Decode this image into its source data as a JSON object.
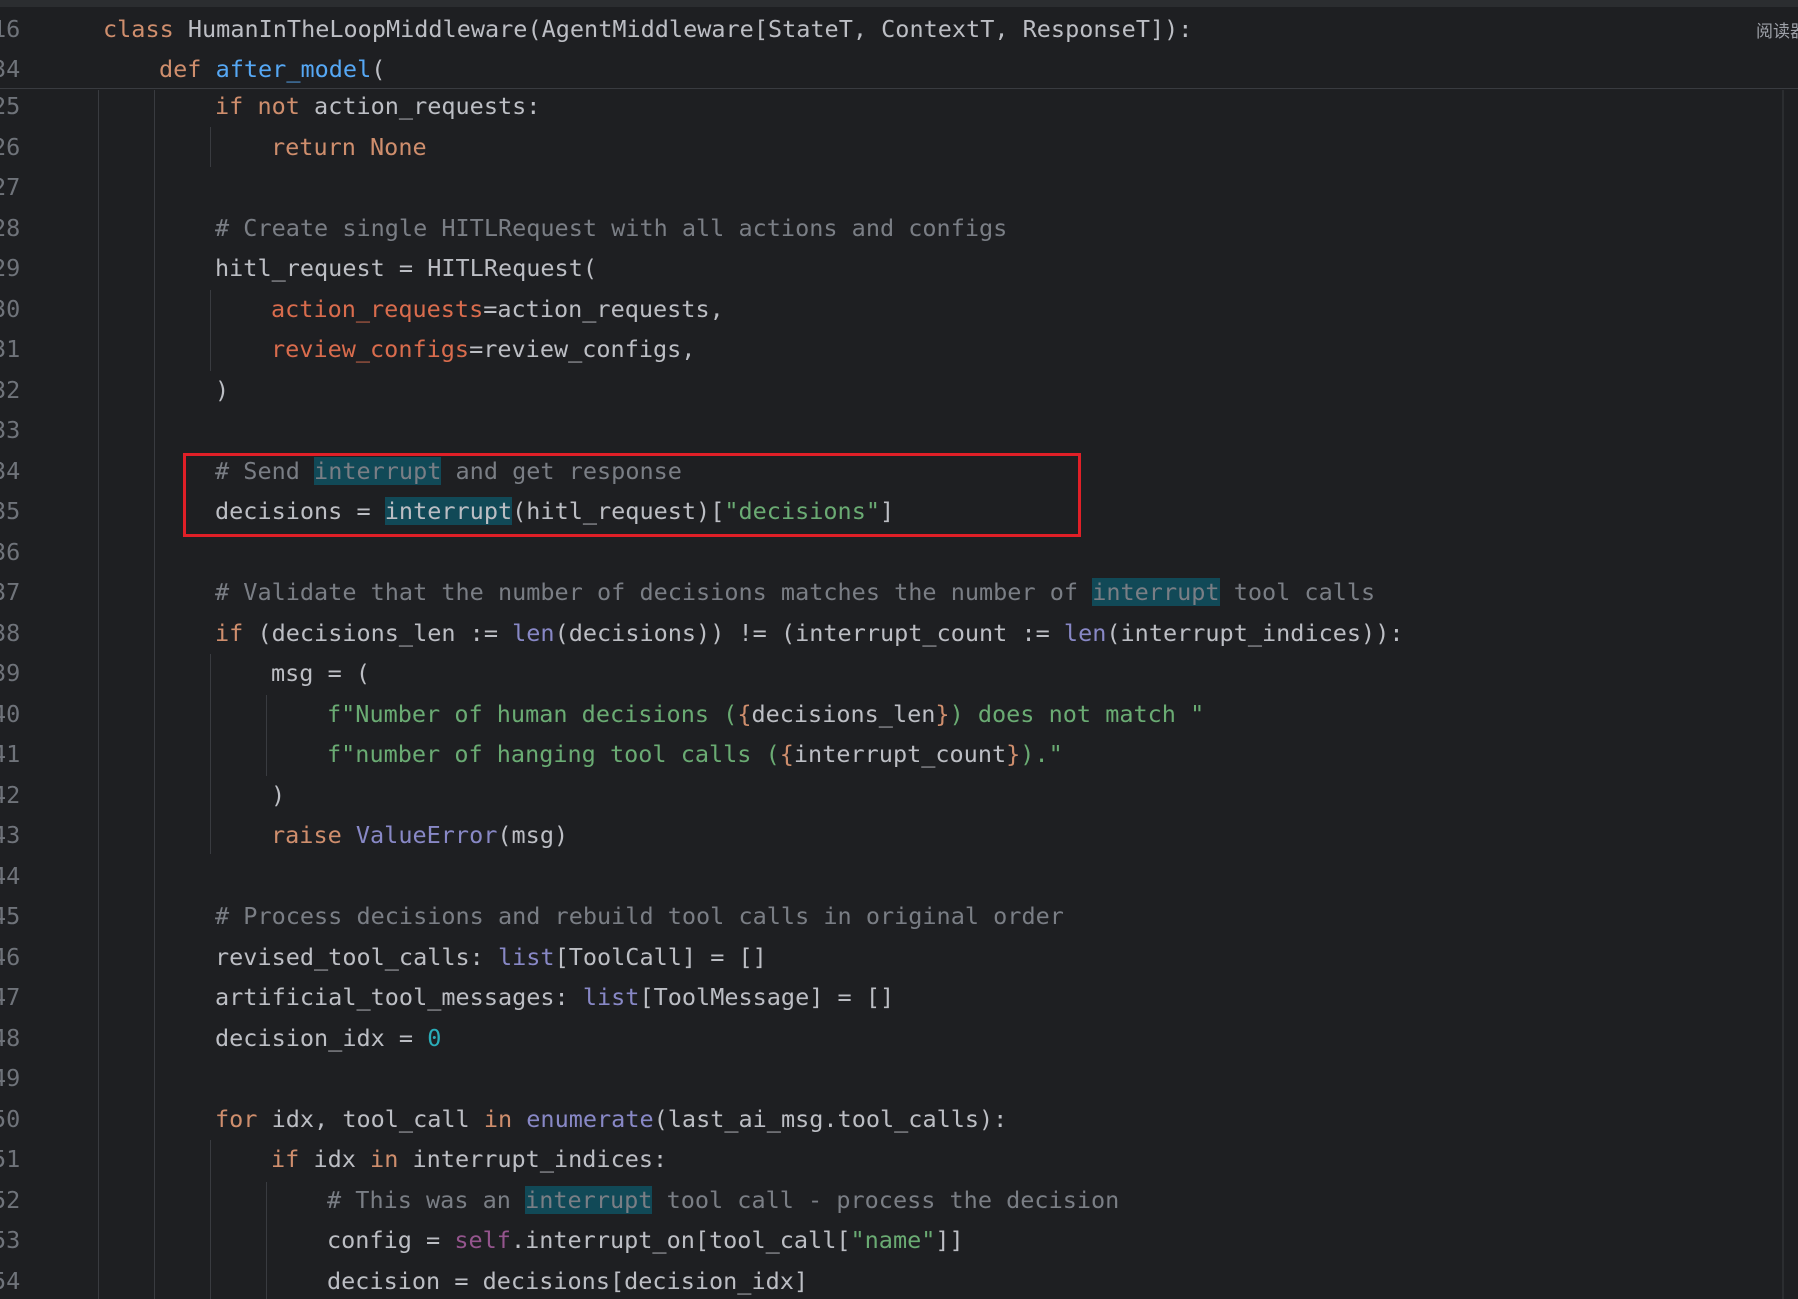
{
  "reader_mode_label": "阅读器",
  "highlight_color": "#e01f27",
  "lines": [
    {
      "ln": "16",
      "indent": 1,
      "segs": [
        [
          "kw",
          "class "
        ],
        [
          "",
          "HumanInTheLoopMiddleware(AgentMiddleware[StateT, ContextT, ResponseT]):"
        ]
      ]
    },
    {
      "ln": "34",
      "indent": 2,
      "segs": [
        [
          "kw",
          "def "
        ],
        [
          "fn",
          "after_model"
        ],
        [
          "",
          "("
        ]
      ]
    },
    {
      "ln": "25",
      "indent": 3,
      "segs": [
        [
          "kw",
          "if not "
        ],
        [
          "",
          "action_requests:"
        ]
      ]
    },
    {
      "ln": "26",
      "indent": 4,
      "segs": [
        [
          "kw",
          "return None"
        ]
      ]
    },
    {
      "ln": "27",
      "indent": 0,
      "segs": []
    },
    {
      "ln": "28",
      "indent": 3,
      "segs": [
        [
          "cm",
          "# Create single HITLRequest with all actions and configs"
        ]
      ]
    },
    {
      "ln": "29",
      "indent": 3,
      "segs": [
        [
          "",
          "hitl_request = HITLRequest("
        ]
      ]
    },
    {
      "ln": "30",
      "indent": 4,
      "segs": [
        [
          "param",
          "action_requests"
        ],
        [
          "",
          "=action_requests,"
        ]
      ]
    },
    {
      "ln": "31",
      "indent": 4,
      "segs": [
        [
          "param",
          "review_configs"
        ],
        [
          "",
          "=review_configs,"
        ]
      ]
    },
    {
      "ln": "32",
      "indent": 3,
      "segs": [
        [
          "",
          ")"
        ]
      ]
    },
    {
      "ln": "33",
      "indent": 0,
      "segs": []
    },
    {
      "ln": "34",
      "indent": 3,
      "segs": [
        [
          "cm",
          "# Send "
        ],
        [
          "cm hl",
          "interrupt"
        ],
        [
          "cm",
          " and get response"
        ]
      ]
    },
    {
      "ln": "35",
      "indent": 3,
      "segs": [
        [
          "",
          "decisions = "
        ],
        [
          "hl",
          "interrupt"
        ],
        [
          "",
          "(hitl_request)["
        ],
        [
          "str",
          "\"decisions\""
        ],
        [
          "",
          "]"
        ]
      ]
    },
    {
      "ln": "36",
      "indent": 0,
      "segs": []
    },
    {
      "ln": "37",
      "indent": 3,
      "segs": [
        [
          "cm",
          "# Validate that the number of decisions matches the number of "
        ],
        [
          "cm hl",
          "interrupt"
        ],
        [
          "cm",
          " tool calls"
        ]
      ]
    },
    {
      "ln": "38",
      "indent": 3,
      "segs": [
        [
          "kw",
          "if "
        ],
        [
          "",
          "(decisions_len := "
        ],
        [
          "bi",
          "len"
        ],
        [
          "",
          "(decisions)) != (interrupt_count := "
        ],
        [
          "bi",
          "len"
        ],
        [
          "",
          "(interrupt_indices)):"
        ]
      ]
    },
    {
      "ln": "39",
      "indent": 4,
      "segs": [
        [
          "",
          "msg = ("
        ]
      ]
    },
    {
      "ln": "40",
      "indent": 5,
      "segs": [
        [
          "str",
          "f\"Number of human decisions ("
        ],
        [
          "kw",
          "{"
        ],
        [
          "",
          "decisions_len"
        ],
        [
          "kw",
          "}"
        ],
        [
          "str",
          ") does not match \""
        ]
      ]
    },
    {
      "ln": "41",
      "indent": 5,
      "segs": [
        [
          "str",
          "f\"number of hanging tool calls ("
        ],
        [
          "kw",
          "{"
        ],
        [
          "",
          "interrupt_count"
        ],
        [
          "kw",
          "}"
        ],
        [
          "str",
          ").\""
        ]
      ]
    },
    {
      "ln": "42",
      "indent": 4,
      "segs": [
        [
          "",
          ")"
        ]
      ]
    },
    {
      "ln": "43",
      "indent": 4,
      "segs": [
        [
          "kw",
          "raise "
        ],
        [
          "bi",
          "ValueError"
        ],
        [
          "",
          "(msg)"
        ]
      ]
    },
    {
      "ln": "44",
      "indent": 0,
      "segs": []
    },
    {
      "ln": "45",
      "indent": 3,
      "segs": [
        [
          "cm",
          "# Process decisions and rebuild tool calls in original order"
        ]
      ]
    },
    {
      "ln": "46",
      "indent": 3,
      "segs": [
        [
          "",
          "revised_tool_calls: "
        ],
        [
          "bi",
          "list"
        ],
        [
          "",
          "[ToolCall] = []"
        ]
      ]
    },
    {
      "ln": "47",
      "indent": 3,
      "segs": [
        [
          "",
          "artificial_tool_messages: "
        ],
        [
          "bi",
          "list"
        ],
        [
          "",
          "[ToolMessage] = []"
        ]
      ]
    },
    {
      "ln": "48",
      "indent": 3,
      "segs": [
        [
          "",
          "decision_idx = "
        ],
        [
          "num",
          "0"
        ]
      ]
    },
    {
      "ln": "49",
      "indent": 0,
      "segs": []
    },
    {
      "ln": "50",
      "indent": 3,
      "segs": [
        [
          "kw",
          "for "
        ],
        [
          "",
          "idx, tool_call "
        ],
        [
          "kw",
          "in "
        ],
        [
          "bi",
          "enumerate"
        ],
        [
          "",
          "(last_ai_msg.tool_calls):"
        ]
      ]
    },
    {
      "ln": "51",
      "indent": 4,
      "segs": [
        [
          "kw",
          "if "
        ],
        [
          "",
          "idx "
        ],
        [
          "kw",
          "in "
        ],
        [
          "",
          "interrupt_indices:"
        ]
      ]
    },
    {
      "ln": "52",
      "indent": 5,
      "segs": [
        [
          "cm",
          "# This was an "
        ],
        [
          "cm hl",
          "interrupt"
        ],
        [
          "cm",
          " tool call - process the decision"
        ]
      ]
    },
    {
      "ln": "53",
      "indent": 5,
      "segs": [
        [
          "",
          "config = "
        ],
        [
          "self",
          "self"
        ],
        [
          "",
          ".interrupt_on[tool_call["
        ],
        [
          "str",
          "\"name\""
        ],
        [
          "",
          "]]"
        ]
      ]
    },
    {
      "ln": "54",
      "indent": 5,
      "segs": [
        [
          "",
          "decision = decisions[decision_idx]"
        ]
      ]
    }
  ]
}
